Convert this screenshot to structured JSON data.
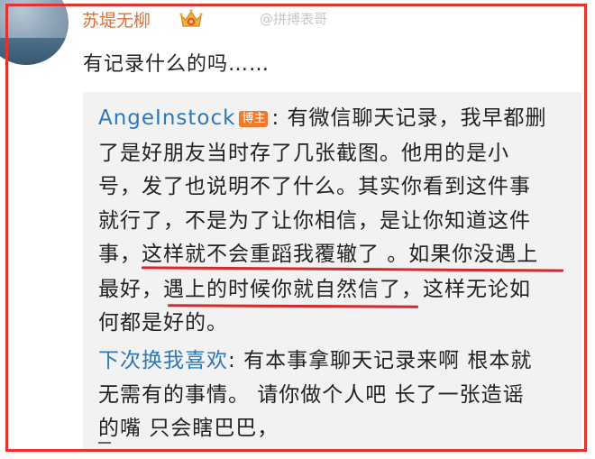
{
  "comment_author": {
    "name": "苏堤无柳",
    "vip_icon": "crown-vip-badge-icon"
  },
  "watermark": "@拼搏表哥",
  "comment_text": "有记录什么的吗……",
  "reply_1": {
    "author": "AngeInstock",
    "badge": "博主",
    "separator": ": ",
    "lines": [
      "有微信聊天记录，我早都删",
      "了是好朋友当时存了几张截图。他用的是小",
      "号，发了也说明不了什么。其实你看到这件事",
      "就行了，不是为了让你相信，是让你知道这件",
      "事，这样就不会重蹈我覆辙了 。如果你没遇上",
      "最好，遇上的时候你就自然信了，这样无论如",
      "何都是好的。"
    ]
  },
  "reply_2": {
    "author": "下次换我喜欢",
    "separator": ": ",
    "lines": [
      "有本事拿聊天记录来啊 根本就",
      "无需有的事情。 请你做个人吧 长了一张造谣",
      "的嘴 只会瞎巴巴，"
    ]
  },
  "colors": {
    "frame": "#e5322d",
    "username": "#e0702c",
    "link": "#2f79b8",
    "badge": "#f07a2c",
    "underline": "#d8282a",
    "reply_bg": "#f2f2f2"
  }
}
